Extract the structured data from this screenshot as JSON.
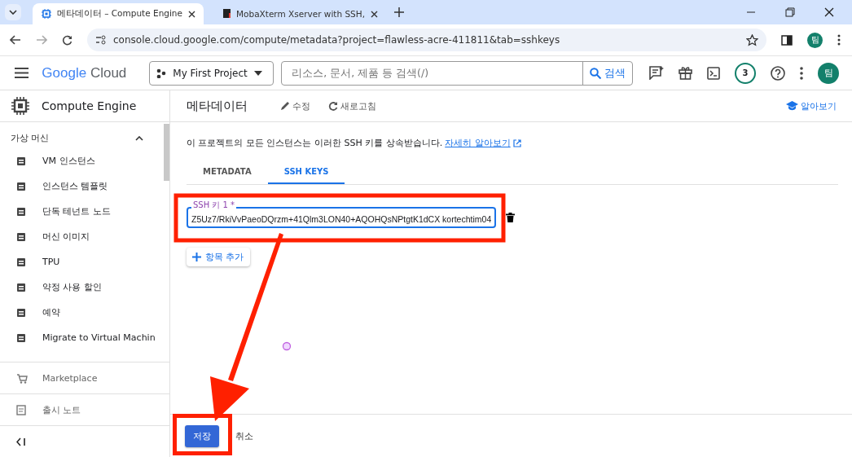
{
  "browser": {
    "tabs": [
      {
        "title": "메타데이터 – Compute Engine",
        "selected": true
      },
      {
        "title": "MobaXterm Xserver with SSH,",
        "selected": false
      }
    ],
    "url": "console.cloud.google.com/compute/metadata?project=flawless-acre-411811&tab=sshkeys",
    "avatar": "팀"
  },
  "header": {
    "logo_word_1": "Google",
    "logo_word_2": "Cloud",
    "project": "My First Project",
    "search_placeholder": "리소스, 문서, 제품 등 검색(/)",
    "search_button": "검색",
    "notifications": "3",
    "avatar": "팀"
  },
  "sidebar": {
    "product": "Compute Engine",
    "section": {
      "label": "가상 머신",
      "expanded": true,
      "items": [
        {
          "label": "VM 인스턴스"
        },
        {
          "label": "인스턴스 템플릿"
        },
        {
          "label": "단독 테넌트 노드"
        },
        {
          "label": "머신 이미지"
        },
        {
          "label": "TPU"
        },
        {
          "label": "약정 사용 할인"
        },
        {
          "label": "예약"
        },
        {
          "label": "Migrate to Virtual Machin"
        }
      ]
    },
    "links": [
      {
        "label": "Marketplace"
      },
      {
        "label": "출시 노트"
      }
    ]
  },
  "page": {
    "title": "메타데이터",
    "actions": [
      {
        "kind": "edit",
        "label": "수정"
      },
      {
        "kind": "refresh",
        "label": "새로고침"
      }
    ],
    "learn": "알아보기",
    "description": "이 프로젝트의 모든 인스턴스는 이러한 SSH 키를 상속받습니다.",
    "description_link": "자세히 알아보기",
    "tabs": [
      {
        "label": "METADATA",
        "selected": false
      },
      {
        "label": "SSH KEYS",
        "selected": true
      }
    ],
    "key_field": {
      "label": "SSH 키 1 *",
      "value": "Z5Uz7/RkiVvPaeoDQrzm+41Qlm3LON40+AQOHQsNPtgtK1dCX kortechtim04"
    },
    "add_button": "항목 추가",
    "save_button": "저장",
    "cancel_button": "취소"
  }
}
